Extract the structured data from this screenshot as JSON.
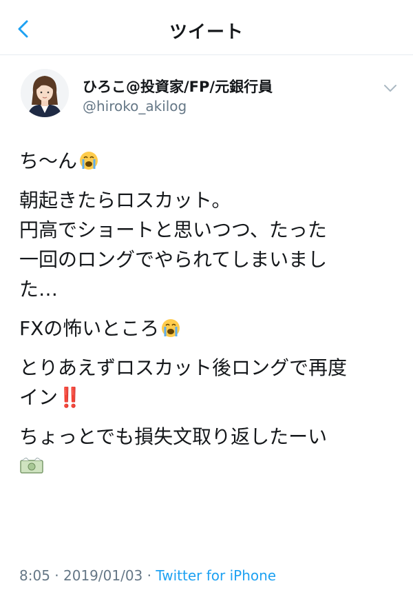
{
  "header": {
    "title": "ツイート",
    "back_icon": "chevron-left-icon",
    "accent_color": "#1da1f2"
  },
  "author": {
    "display_name": "ひろこ@投資家/FP/元銀行員",
    "handle": "@hiroko_akilog",
    "menu_icon": "chevron-down-icon"
  },
  "tweet": {
    "p1": "ち〜ん",
    "p2_l1": "朝起きたらロスカット。",
    "p2_l2": "円高でショートと思いつつ、たった",
    "p2_l3": "一回のロングでやられてしまいまし",
    "p2_l4": "た…",
    "p3": "FXの怖いところ",
    "p4_l1": "とりあえずロスカット後ロングで再度",
    "p4_l2": "イン",
    "p4_bang": "‼️",
    "p5": "ちょっとでも損失文取り返したーい",
    "emojis": [
      "loudly-crying-face-icon",
      "double-exclamation-icon",
      "money-with-wings-icon"
    ]
  },
  "meta": {
    "time": "8:05",
    "sep1": " · ",
    "date": "2019/01/03",
    "sep2": " · ",
    "source": "Twitter for iPhone"
  }
}
